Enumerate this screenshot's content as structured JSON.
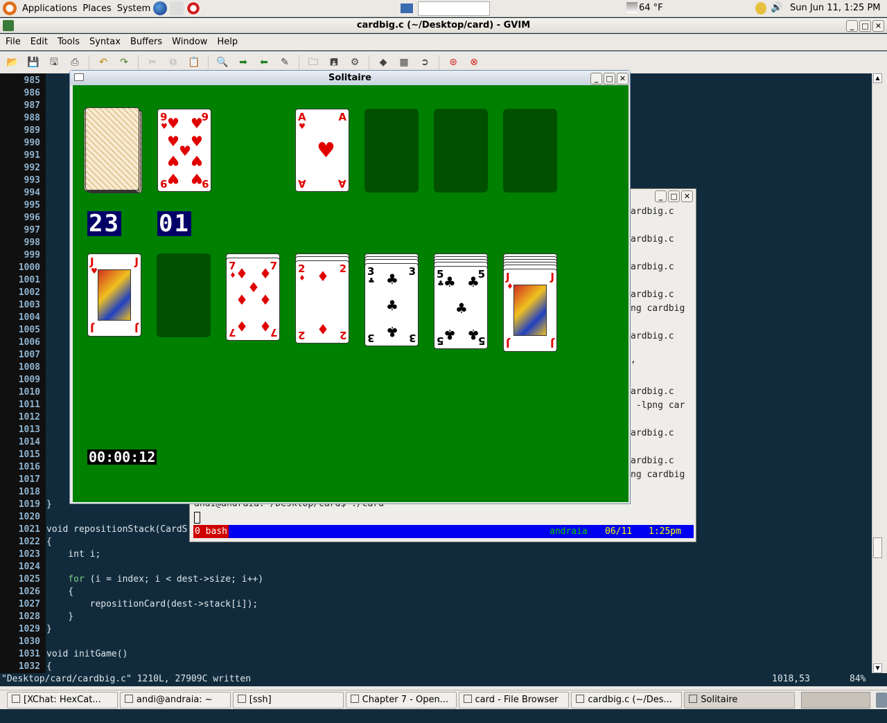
{
  "top_panel": {
    "menus": [
      "Applications",
      "Places",
      "System"
    ],
    "icons": [
      "ubuntu-logo-icon",
      "firefox-icon",
      "mail-clock-icon",
      "help-lifebuoy-icon"
    ],
    "weather": "64 °F",
    "clock": "Sun Jun 11,  1:25 PM"
  },
  "gvim": {
    "title": "cardbig.c (~/Desktop/card) - GVIM",
    "menu": [
      "File",
      "Edit",
      "Tools",
      "Syntax",
      "Buffers",
      "Window",
      "Help"
    ],
    "line_numbers": [
      "985",
      "986",
      "987",
      "988",
      "989",
      "990",
      "991",
      "992",
      "993",
      "994",
      "995",
      "996",
      "997",
      "998",
      "999",
      "1000",
      "1001",
      "1002",
      "1003",
      "1004",
      "1005",
      "1006",
      "1007",
      "1008",
      "1009",
      "1010",
      "1011",
      "1012",
      "1013",
      "1014",
      "1015",
      "1016",
      "1017",
      "1018",
      "1019",
      "1020",
      "1021",
      "1022",
      "1023",
      "1024",
      "1025",
      "1026",
      "1027",
      "1028",
      "1029",
      "1030",
      "1031",
      "1032"
    ],
    "code": {
      "l1019": "}",
      "l1021": "void repositionStack(CardS",
      "l1022": "{",
      "l1023": "    int i;",
      "l1025_kw": "    for",
      "l1025": " (i = index; i < dest->size; i++)",
      "l1026": "    {",
      "l1027": "        repositionCard(dest->stack[i]);",
      "l1028": "    }",
      "l1029": "}",
      "l1031": "void initGame()",
      "l1032": "{"
    },
    "status_msg": "\"Desktop/card/cardbig.c\" 1210L, 27909C written",
    "cursor_pos": "1018,53",
    "scroll_percent": "84%"
  },
  "terminal": {
    "lines": [
      "ardbig.c",
      "ardbig.c",
      "ardbig.c",
      "ardbig.c",
      "ng cardbig",
      "ardbig.c",
      ",",
      "ardbig.c",
      " -lpng car",
      "ardbig.c",
      "ardbig.c",
      "ng cardbig"
    ],
    "prompt": "andi@andraia:~/Desktop/card$ ./card",
    "status": {
      "window": "0 bash",
      "host": "andraia",
      "date": "06/11",
      "time": "1:25pm"
    },
    "colors": {
      "bar": "#0000f0",
      "window": "#d00000",
      "host": "#00d000",
      "date": "#ffff00"
    }
  },
  "solitaire": {
    "title": "Solitaire",
    "felt_color": "#008000",
    "waste": {
      "rank": "9",
      "suit": "♥"
    },
    "foundations": [
      {
        "rank": "A",
        "suit": "♥"
      },
      null,
      null,
      null
    ],
    "stock_count": "23",
    "pass_count": "01",
    "timer": "00:00:12",
    "tableau": [
      {
        "rank": "J",
        "suit": "♥",
        "hidden": 0
      },
      null,
      {
        "rank": "7",
        "suit": "♦",
        "hidden": 1
      },
      {
        "rank": "2",
        "suit": "♦",
        "hidden": 2
      },
      {
        "rank": "3",
        "suit": "♣",
        "hidden": 3
      },
      {
        "rank": "5",
        "suit": "♣",
        "hidden": 4
      },
      {
        "rank": "J",
        "suit": "♦",
        "hidden": 5
      }
    ]
  },
  "taskbar": [
    "[XChat: HexCat...",
    "andi@andraia: ~",
    "[ssh]",
    "Chapter 7 - Open...",
    "card - File Browser",
    "cardbig.c (~/Des...",
    "Solitaire"
  ]
}
